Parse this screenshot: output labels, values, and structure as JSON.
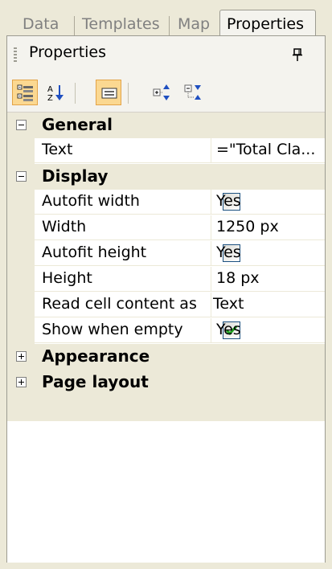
{
  "tabs": [
    "Data",
    "Templates",
    "Map",
    "Properties"
  ],
  "panel": {
    "title": "Properties"
  },
  "toolbar": {
    "categorized": {
      "icon": "categorized-icon",
      "active": true
    },
    "alphabetical": {
      "icon": "sort-az-icon",
      "active": false
    },
    "property_pages": {
      "icon": "property-pages-icon",
      "active": true
    },
    "expand_all": {
      "icon": "expand-all-icon",
      "active": false
    },
    "collapse_all": {
      "icon": "collapse-all-icon",
      "active": false
    }
  },
  "grid": {
    "general": {
      "label": "General",
      "expanded": true,
      "text": {
        "name": "Text",
        "value": "=\"Total Cla..."
      }
    },
    "display": {
      "label": "Display",
      "expanded": true,
      "autofit_width": {
        "name": "Autofit width",
        "checked": false,
        "value": "Yes"
      },
      "width": {
        "name": "Width",
        "value": "1250 px"
      },
      "autofit_height": {
        "name": "Autofit height",
        "checked": false,
        "value": "Yes"
      },
      "height": {
        "name": "Height",
        "value": "18 px"
      },
      "read_cell": {
        "name": "Read cell content as",
        "value": "Text"
      },
      "show_empty": {
        "name": "Show when empty",
        "checked": true,
        "value": "Yes"
      }
    },
    "appearance": {
      "label": "Appearance",
      "expanded": false
    },
    "page_layout": {
      "label": "Page layout",
      "expanded": false
    }
  },
  "colors": {
    "checkmark": "#21a121",
    "active_button": "#fbd891",
    "category_bg": "#ece9d8"
  }
}
